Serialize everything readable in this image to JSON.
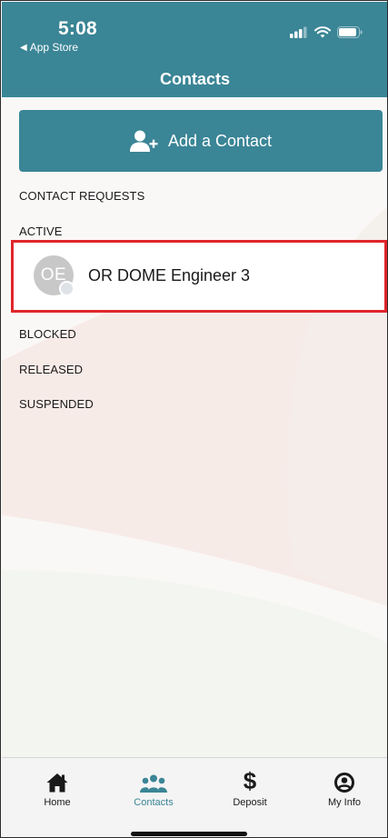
{
  "status_bar": {
    "time": "5:08",
    "back_app": "App Store"
  },
  "header": {
    "title": "Contacts"
  },
  "add_contact": {
    "label": "Add a Contact",
    "icon": "add-person-icon"
  },
  "sections": {
    "contact_requests": "CONTACT REQUESTS",
    "active": "ACTIVE",
    "blocked": "BLOCKED",
    "released": "RELEASED",
    "suspended": "SUSPENDED"
  },
  "active_contacts": [
    {
      "initials": "OE",
      "name": "OR DOME Engineer 3"
    }
  ],
  "tabbar": {
    "tabs": [
      {
        "label": "Home",
        "icon": "home-icon"
      },
      {
        "label": "Contacts",
        "icon": "contacts-icon"
      },
      {
        "label": "Deposit",
        "icon": "dollar-icon"
      },
      {
        "label": "My Info",
        "icon": "user-circle-icon"
      }
    ],
    "active_tab": "Contacts"
  },
  "colors": {
    "brand_teal": "#3a8596",
    "highlight_red": "#e0262b"
  }
}
